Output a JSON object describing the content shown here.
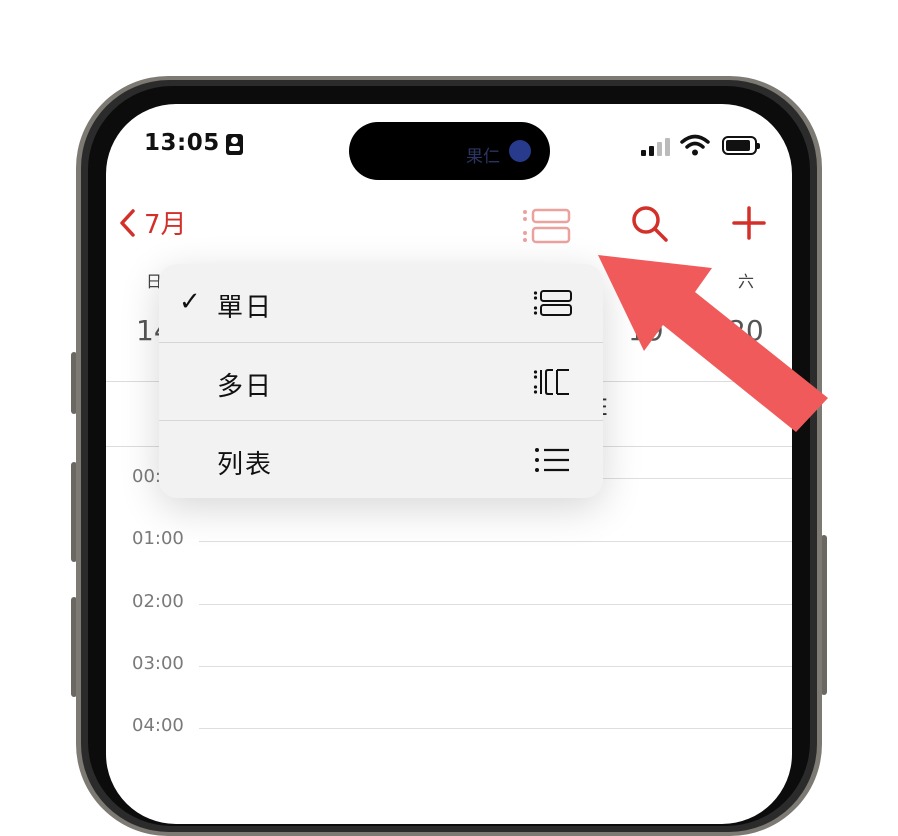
{
  "status_bar": {
    "time": "13:05",
    "island_text": "果仁"
  },
  "nav": {
    "back_label": "7月"
  },
  "week": {
    "first_day_label": "日",
    "last_day_label": "六",
    "first_day_num": "14",
    "partial_day_num": "19",
    "last_day_num": "20",
    "partial_text": "E"
  },
  "hours": [
    "00:00",
    "01:00",
    "02:00",
    "03:00",
    "04:00"
  ],
  "menu": {
    "items": [
      {
        "label": "單日",
        "checked": true,
        "icon": "single-day-icon"
      },
      {
        "label": "多日",
        "checked": false,
        "icon": "multi-day-icon"
      },
      {
        "label": "列表",
        "checked": false,
        "icon": "list-icon"
      }
    ],
    "check_glyph": "✓"
  },
  "colors": {
    "accent": "#d4302a",
    "annotation_arrow": "#f05a5a"
  }
}
